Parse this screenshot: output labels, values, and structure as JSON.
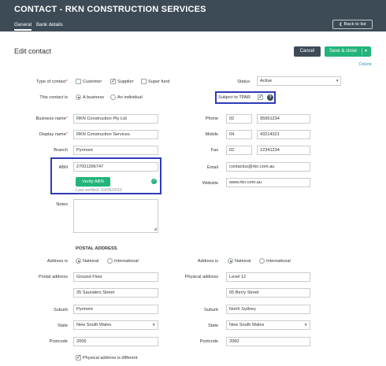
{
  "header": {
    "title": "CONTACT - RKN CONSTRUCTION SERVICES",
    "tabs": [
      "General",
      "Bank details"
    ],
    "back_label": "Back to list"
  },
  "page": {
    "title": "Edit contact",
    "cancel_label": "Cancel",
    "save_label": "Save & close",
    "delete_label": "Delete"
  },
  "left": {
    "type_label": "Type of contact",
    "type_options": [
      "Customer",
      "Supplier",
      "Super fund"
    ],
    "type_selected": "Supplier",
    "contact_is_label": "This contact is",
    "contact_is_options": [
      "A business",
      "An individual"
    ],
    "contact_is_selected": "A business",
    "business_name_label": "Business name",
    "business_name": "RKN Construction Pty Ltd",
    "display_name_label": "Display name",
    "display_name": "RKN Construction Services",
    "branch_label": "Branch",
    "branch": "Pyrmont",
    "abn_label": "ABN",
    "abn": "27001396747",
    "verify_label": "Verify ABN",
    "last_verified": "Last verified: 03/06/2016",
    "notes_label": "Notes"
  },
  "right": {
    "status_label": "Status",
    "status": "Active",
    "tpar_label": "Subject to TPAR",
    "phone_label": "Phone",
    "phone_area": "02",
    "phone": "95951234",
    "mobile_label": "Mobile",
    "mobile_area": "04",
    "mobile": "43214321",
    "fax_label": "Fax",
    "fax_area": "02",
    "fax": "12341234",
    "email_label": "Email",
    "email": "contactus@rkn.com.au",
    "website_label": "Website",
    "website": "www.rkn.com.au"
  },
  "postal": {
    "heading": "POSTAL ADDRESS",
    "address_is_label": "Address is",
    "options": [
      "National",
      "International"
    ],
    "postal_address_label": "Postal address",
    "line1": "Ground Floor",
    "line2": "35 Saunders Street",
    "suburb_label": "Suburb",
    "suburb": "Pyrmont",
    "state_label": "State",
    "state": "New South Wales",
    "postcode_label": "Postcode",
    "postcode": "2006",
    "different_label": "Physical address is different"
  },
  "physical": {
    "address_is_label": "Address is",
    "options": [
      "National",
      "International"
    ],
    "physical_address_label": "Physical address",
    "line1": "Level 12",
    "line2": "65 Berry Street",
    "suburb_label": "Suburb",
    "suburb": "North Sydney",
    "state_label": "State",
    "state": "New South Wales",
    "postcode_label": "Postcode",
    "postcode": "2060"
  },
  "required_marker": "*",
  "colors": {
    "header": "#3d4b57",
    "accent": "#22b47a",
    "highlight": "#2f3bb8",
    "link": "#2f9cc7"
  }
}
